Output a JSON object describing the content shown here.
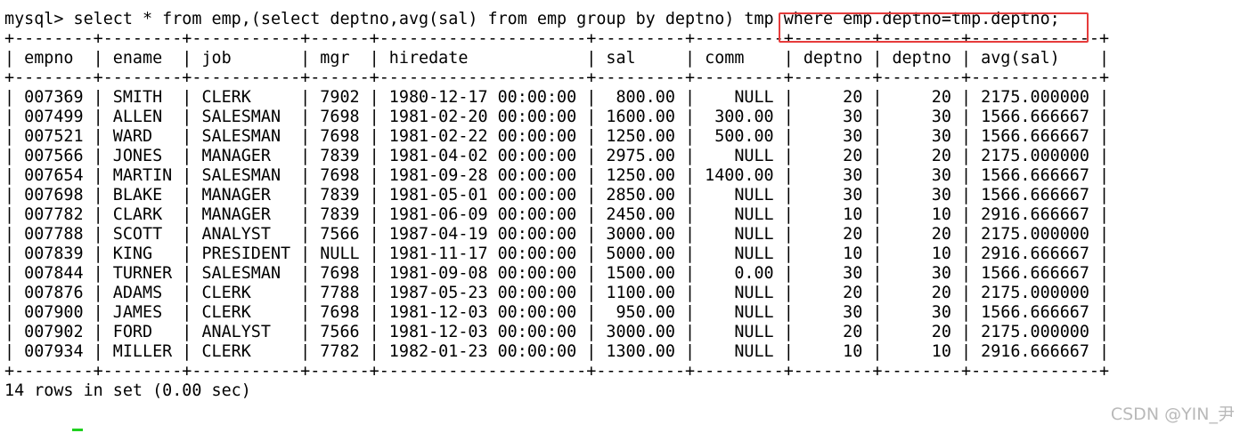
{
  "terminal": {
    "command": "mysql> select * from emp,(select deptno,avg(sal) from emp group by deptno) tmp where emp.deptno=tmp.deptno;",
    "columns": [
      "empno",
      "ename",
      "job",
      "mgr",
      "hiredate",
      "sal",
      "comm",
      "deptno",
      "deptno",
      "avg(sal)"
    ],
    "rows": [
      [
        "007369",
        "SMITH",
        "CLERK",
        "7902",
        "1980-12-17 00:00:00",
        "800.00",
        "NULL",
        "20",
        "20",
        "2175.000000"
      ],
      [
        "007499",
        "ALLEN",
        "SALESMAN",
        "7698",
        "1981-02-20 00:00:00",
        "1600.00",
        "300.00",
        "30",
        "30",
        "1566.666667"
      ],
      [
        "007521",
        "WARD",
        "SALESMAN",
        "7698",
        "1981-02-22 00:00:00",
        "1250.00",
        "500.00",
        "30",
        "30",
        "1566.666667"
      ],
      [
        "007566",
        "JONES",
        "MANAGER",
        "7839",
        "1981-04-02 00:00:00",
        "2975.00",
        "NULL",
        "20",
        "20",
        "2175.000000"
      ],
      [
        "007654",
        "MARTIN",
        "SALESMAN",
        "7698",
        "1981-09-28 00:00:00",
        "1250.00",
        "1400.00",
        "30",
        "30",
        "1566.666667"
      ],
      [
        "007698",
        "BLAKE",
        "MANAGER",
        "7839",
        "1981-05-01 00:00:00",
        "2850.00",
        "NULL",
        "30",
        "30",
        "1566.666667"
      ],
      [
        "007782",
        "CLARK",
        "MANAGER",
        "7839",
        "1981-06-09 00:00:00",
        "2450.00",
        "NULL",
        "10",
        "10",
        "2916.666667"
      ],
      [
        "007788",
        "SCOTT",
        "ANALYST",
        "7566",
        "1987-04-19 00:00:00",
        "3000.00",
        "NULL",
        "20",
        "20",
        "2175.000000"
      ],
      [
        "007839",
        "KING",
        "PRESIDENT",
        "NULL",
        "1981-11-17 00:00:00",
        "5000.00",
        "NULL",
        "10",
        "10",
        "2916.666667"
      ],
      [
        "007844",
        "TURNER",
        "SALESMAN",
        "7698",
        "1981-09-08 00:00:00",
        "1500.00",
        "0.00",
        "30",
        "30",
        "1566.666667"
      ],
      [
        "007876",
        "ADAMS",
        "CLERK",
        "7788",
        "1987-05-23 00:00:00",
        "1100.00",
        "NULL",
        "20",
        "20",
        "2175.000000"
      ],
      [
        "007900",
        "JAMES",
        "CLERK",
        "7698",
        "1981-12-03 00:00:00",
        "950.00",
        "NULL",
        "30",
        "30",
        "1566.666667"
      ],
      [
        "007902",
        "FORD",
        "ANALYST",
        "7566",
        "1981-12-03 00:00:00",
        "3000.00",
        "NULL",
        "20",
        "20",
        "2175.000000"
      ],
      [
        "007934",
        "MILLER",
        "CLERK",
        "7782",
        "1982-01-23 00:00:00",
        "1300.00",
        "NULL",
        "10",
        "10",
        "2916.666667"
      ]
    ],
    "summary": "14 rows in set (0.00 sec)"
  },
  "watermark": "CSDN @YIN_尹",
  "colors": {
    "highlight": "#e63b3b",
    "cursor": "#1fd01f",
    "watermark": "#b9b9b9"
  }
}
